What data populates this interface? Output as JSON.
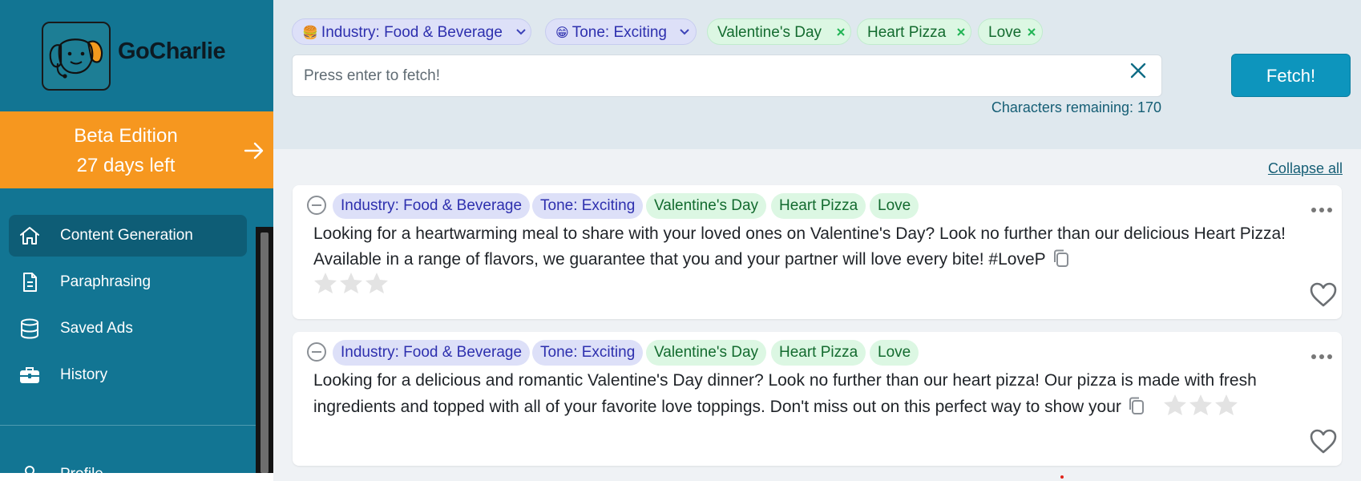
{
  "brand": {
    "name": "GoCharlie",
    "logo_icon": "dog-logo-icon"
  },
  "beta": {
    "line1": "Beta Edition",
    "line2": "27 days left",
    "arrow_icon": "arrow-right-icon"
  },
  "nav": [
    {
      "label": "Content Generation",
      "icon": "home-icon",
      "active": true
    },
    {
      "label": "Paraphrasing",
      "icon": "document-icon",
      "active": false
    },
    {
      "label": "Saved Ads",
      "icon": "database-icon",
      "active": false
    },
    {
      "label": "History",
      "icon": "briefcase-icon",
      "active": false
    },
    {
      "label": "Profile",
      "icon": "user-icon",
      "active": false
    }
  ],
  "filters": {
    "industry": {
      "emoji": "🍔",
      "label": "Industry: Food & Beverage"
    },
    "tone": {
      "emoji": "😁",
      "label": "Tone: Exciting"
    },
    "keywords": [
      "Valentine's Day",
      "Heart Pizza",
      "Love"
    ]
  },
  "search": {
    "placeholder": "Press enter to fetch!",
    "value": ""
  },
  "fetch_label": "Fetch!",
  "chars_remaining": "Characters remaining: 170",
  "collapse_all": "Collapse all",
  "results": [
    {
      "tags": [
        "Industry: Food & Beverage",
        "Tone: Exciting",
        "Valentine's Day",
        "Heart Pizza",
        "Love"
      ],
      "text": "Looking for a heartwarming meal to share with your loved ones on Valentine's Day? Look no further than our delicious Heart Pizza! Available in a range of flavors, we guarantee that you and your partner will love every bite! #LoveP",
      "rating": 0,
      "rating_max": 3
    },
    {
      "tags": [
        "Industry: Food & Beverage",
        "Tone: Exciting",
        "Valentine's Day",
        "Heart Pizza",
        "Love"
      ],
      "text": "Looking for a delicious and romantic Valentine's Day dinner? Look no further than our heart pizza! Our pizza is made with fresh ingredients and topped with all of your favorite love toppings. Don't miss out on this perfect way to show your",
      "rating": 0,
      "rating_max": 3
    }
  ],
  "colors": {
    "sidebar": "#127593",
    "beta": "#f6971f",
    "fetch_button": "#0d95bd",
    "tag_blue_bg": "#dde0f8",
    "tag_green_bg": "#dcf7e3"
  }
}
